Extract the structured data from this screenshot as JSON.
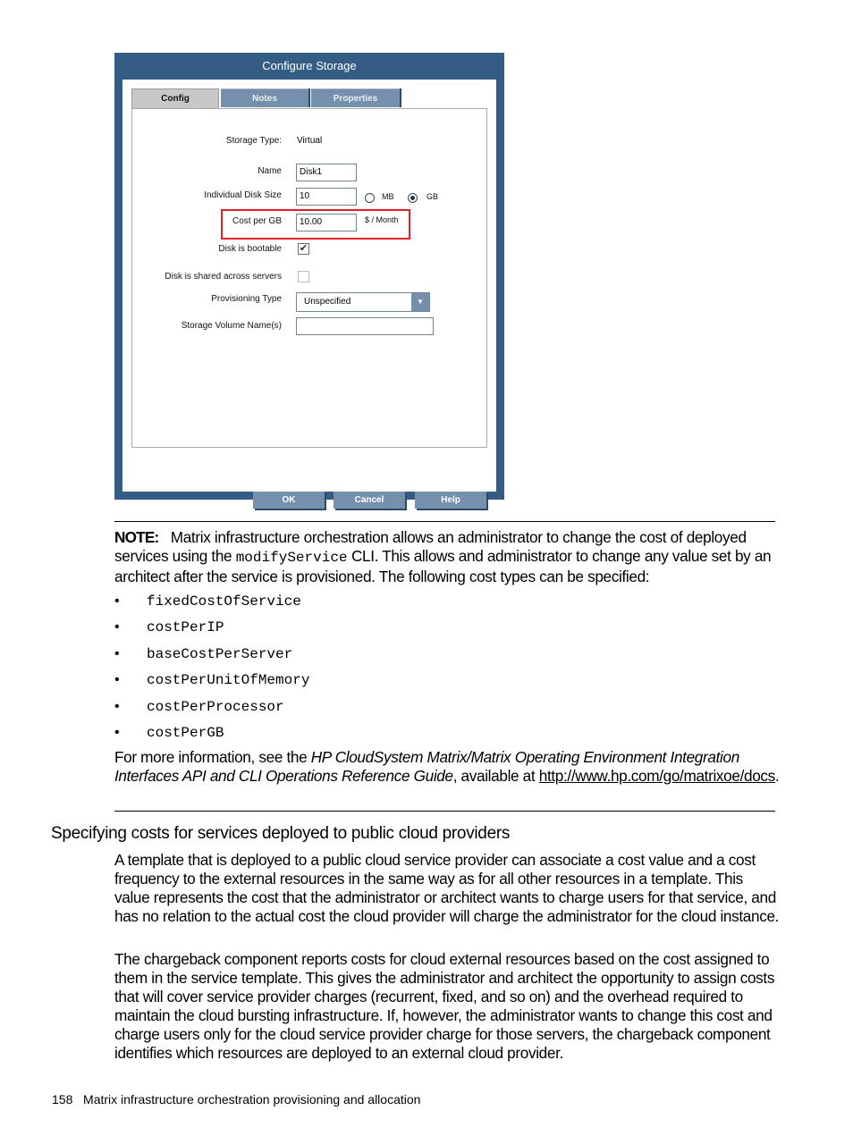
{
  "dialog": {
    "title": "Configure Storage",
    "tabs": [
      {
        "label": "Config",
        "active": true
      },
      {
        "label": "Notes",
        "active": false
      },
      {
        "label": "Properties",
        "active": false
      }
    ],
    "fields": {
      "storage_type_label": "Storage Type:",
      "storage_type_value": "Virtual",
      "name_label": "Name",
      "name_value": "Disk1",
      "disk_size_label": "Individual Disk Size",
      "disk_size_value": "10",
      "unit_mb": "MB",
      "unit_gb": "GB",
      "unit_selected": "GB",
      "cost_label": "Cost per GB",
      "cost_value": "10.00",
      "cost_unit": "$ / Month",
      "bootable_label": "Disk is bootable",
      "bootable_checked": true,
      "shared_label": "Disk is shared across servers",
      "shared_checked": false,
      "provisioning_label": "Provisioning Type",
      "provisioning_value": "Unspecified",
      "volume_label": "Storage Volume Name(s)",
      "volume_value": ""
    },
    "buttons": {
      "ok": "OK",
      "cancel": "Cancel",
      "help": "Help"
    }
  },
  "note": {
    "label": "NOTE:",
    "text_1": "Matrix infrastructure orchestration allows an administrator to change the cost of deployed services using the ",
    "code": "modifyService",
    "text_2": " CLI. This allows and administrator to change any value set by an architect after the service is provisioned. The following cost types can be specified:",
    "bullets": [
      "fixedCostOfService",
      "costPerIP",
      "baseCostPerServer",
      "costPerUnitOfMemory",
      "costPerProcessor",
      "costPerGB"
    ],
    "more_info_prefix": "For more information, see the ",
    "guide_title": "HP CloudSystem Matrix/Matrix Operating Environment Integration Interfaces API and CLI Operations Reference Guide",
    "more_info_mid": ", available at ",
    "link": "http://www.hp.com/go/matrixoe/docs",
    "more_info_suffix": "."
  },
  "section": {
    "heading": "Specifying costs for services deployed to public cloud providers",
    "paragraphs": [
      "A template that is deployed to a public cloud service provider can associate a cost value and a cost frequency to the external resources in the same way as for all other resources in a template. This value represents the cost that the administrator or architect wants to charge users for that service, and has no relation to the actual cost the cloud provider will charge the administrator for the cloud instance.",
      "The chargeback component reports costs for cloud external resources based on the cost assigned to them in the service template. This gives the administrator and architect the opportunity to assign costs that will cover service provider charges (recurrent, fixed, and so on) and the overhead required to maintain the cloud bursting infrastructure. If, however, the administrator wants to change this cost and charge users only for the cloud service provider charge for those servers, the chargeback component identifies which resources are deployed to an external cloud provider."
    ]
  },
  "footer": {
    "page_number": "158",
    "chapter": "Matrix infrastructure orchestration provisioning and allocation"
  }
}
